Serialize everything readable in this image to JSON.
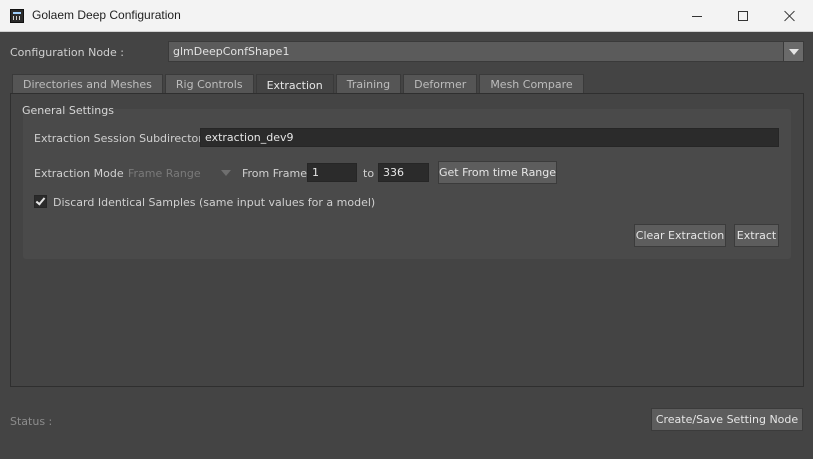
{
  "window": {
    "title": "Golaem Deep Configuration",
    "icon": "golaem-app-icon"
  },
  "config": {
    "label": "Configuration Node :",
    "value": "glmDeepConfShape1"
  },
  "tabs": [
    {
      "label": "Directories and Meshes",
      "active": false
    },
    {
      "label": "Rig Controls",
      "active": false
    },
    {
      "label": "Extraction",
      "active": true
    },
    {
      "label": "Training",
      "active": false
    },
    {
      "label": "Deformer",
      "active": false
    },
    {
      "label": "Mesh Compare",
      "active": false
    }
  ],
  "general": {
    "title": "General Settings",
    "session_label": "Extraction Session Subdirectory",
    "session_value": "extraction_dev9",
    "mode_label": "Extraction Mode",
    "mode_value": "Frame Range",
    "from_label": "From Frame",
    "from_value": "1",
    "to_label": "to",
    "to_value": "336",
    "get_range_button": "Get From time Range",
    "discard_label": "Discard Identical Samples (same input values for a model)",
    "discard_checked": true,
    "clear_button": "Clear Extraction",
    "extract_button": "Extract"
  },
  "footer": {
    "status_label": "Status :",
    "save_button": "Create/Save Setting Node"
  }
}
